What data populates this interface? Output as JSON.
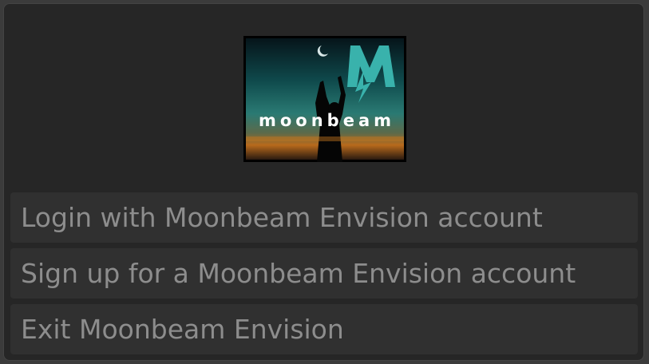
{
  "logo": {
    "wordmark": "moonbeam",
    "emblem": "M",
    "accent_color": "#39b2ac"
  },
  "menu": {
    "login_label": "Login with Moonbeam Envision account",
    "signup_label": "Sign up for a Moonbeam Envision account",
    "exit_label": "Exit Moonbeam Envision"
  }
}
